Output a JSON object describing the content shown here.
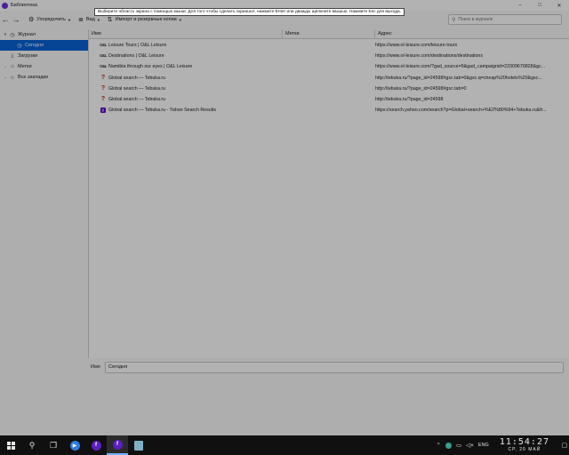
{
  "window": {
    "title": "Библиотека",
    "controls": {
      "minimize": "–",
      "maximize": "□",
      "close": "✕"
    }
  },
  "toolbar": {
    "back": "←",
    "forward": "→",
    "organize_label": "Упорядочить",
    "views_label": "Вид",
    "import_label": "Импорт и резервные копии",
    "search_placeholder": "Поиск в журнале"
  },
  "sidebar": {
    "items": [
      {
        "label": "Журнал",
        "twisty": "▾",
        "icon": "clock-icon"
      },
      {
        "label": "Сегодня",
        "twisty": "",
        "icon": "clock-icon"
      },
      {
        "label": "Загрузки",
        "twisty": "",
        "icon": "download-icon"
      },
      {
        "label": "Метки",
        "twisty": "›",
        "icon": "tag-icon"
      },
      {
        "label": "Все закладки",
        "twisty": "›",
        "icon": "star-icon"
      }
    ]
  },
  "table": {
    "headers": {
      "name": "Имя",
      "tags": "Метки",
      "address": "Адрес"
    },
    "rows": [
      {
        "favicon": "ol",
        "name": "Leisure Tours | O&L Leisure",
        "address": "https://www.ol-leisure.com/leisure-tours"
      },
      {
        "favicon": "ol",
        "name": "Destinations | O&L Leisure",
        "address": "https://www.ol-leisure.com/destinations/destinations"
      },
      {
        "favicon": "ol",
        "name": "Namibia through our eyes | O&L Leisure",
        "address": "https://www.ol-leisure.com/?gad_source=5&gad_campaignid=22309670828&gc..."
      },
      {
        "favicon": "q",
        "name": "Global search — Tebuka.ru",
        "address": "http://tebuka.ru/?page_id=24598#gsc.tab=0&gsc.q=cheap%20hotels%20&gsc..."
      },
      {
        "favicon": "q",
        "name": "Global search — Tebuka.ru",
        "address": "http://tebuka.ru/?page_id=24598#gsc.tab=0"
      },
      {
        "favicon": "q",
        "name": "Global search — Tebuka.ru",
        "address": "http://tebuka.ru/?page_id=24598"
      },
      {
        "favicon": "y",
        "name": "Global search — Tebuka.ru - Yahoo Search Results",
        "address": "https://search.yahoo.com/search?p=Global+search+%E2%80%94+Tebuka.ru&fr..."
      }
    ]
  },
  "details": {
    "name_label": "Имя",
    "name_value": "Сегодня"
  },
  "overlay": {
    "hint_text": "Выберите область экрана с помощью мыши. Для того чтобы сделать скриншот, нажмите Enter или дважды щёлкните мышью. Нажмите Esc для выхода."
  },
  "taskbar": {
    "language": "ENG",
    "time": "11:54:27",
    "date": "СР, 20 МАЙ"
  }
}
